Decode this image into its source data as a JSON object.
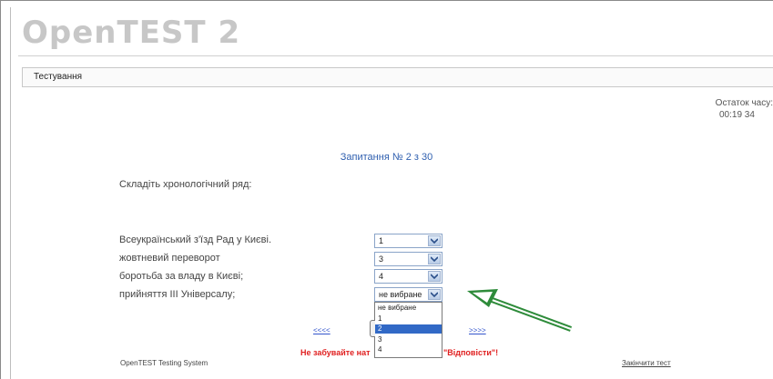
{
  "logo": {
    "text": "OpenTEST 2"
  },
  "navbar": {
    "title": "Тестування"
  },
  "timer": {
    "label": "Остаток часу:",
    "value": "00:19 34"
  },
  "question": {
    "heading": "Запитання № 2 з 30",
    "text": "Складіть хронологічний ряд:",
    "items": [
      {
        "label": "Всеукраїнський з'їзд Рад у Києві.",
        "selected": "1"
      },
      {
        "label": "жовтневий переворот",
        "selected": "3"
      },
      {
        "label": "боротьба за владу в Києві;",
        "selected": "4"
      },
      {
        "label": "прийняття III Універсалу;",
        "selected": "не вибране"
      }
    ]
  },
  "dropdown": {
    "options": [
      "не вибране",
      "1",
      "2",
      "3",
      "4"
    ],
    "highlighted": "2"
  },
  "navigation": {
    "prev": "<<<<",
    "next": ">>>>"
  },
  "warning": {
    "left": "Не забувайте нат",
    "right": "\"Відповісти\"!"
  },
  "footer": {
    "system": "OpenTEST Testing System",
    "finish": "Закінчити тест"
  },
  "colors": {
    "accent": "#2f5faf",
    "warning": "#e02020",
    "arrow": "#2e8b3a",
    "highlight": "#3169c6"
  }
}
